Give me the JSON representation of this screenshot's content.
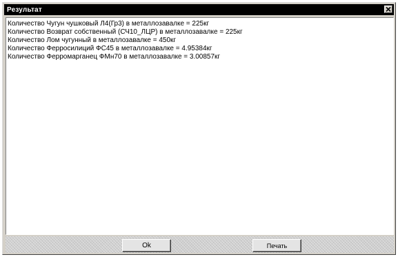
{
  "window": {
    "title": "Результат",
    "close_label": "×"
  },
  "results": [
    "Количество Чугун чушковый Л4(Гр3) в металлозавалке = 225кг",
    "Количество Возврат собственный (СЧ10_ЛЦР) в металлозавалке = 225кг",
    "Количество Лом чугунный в металлозавалке = 450кг",
    "Количество Ферросилиций ФС45 в металлозавалке = 4.95384кг",
    "Количество Ферромарганец ФМн70 в металлозавалке = 3.00857кг"
  ],
  "buttons": {
    "ok_label": "Ok",
    "print_label": "Печать"
  }
}
